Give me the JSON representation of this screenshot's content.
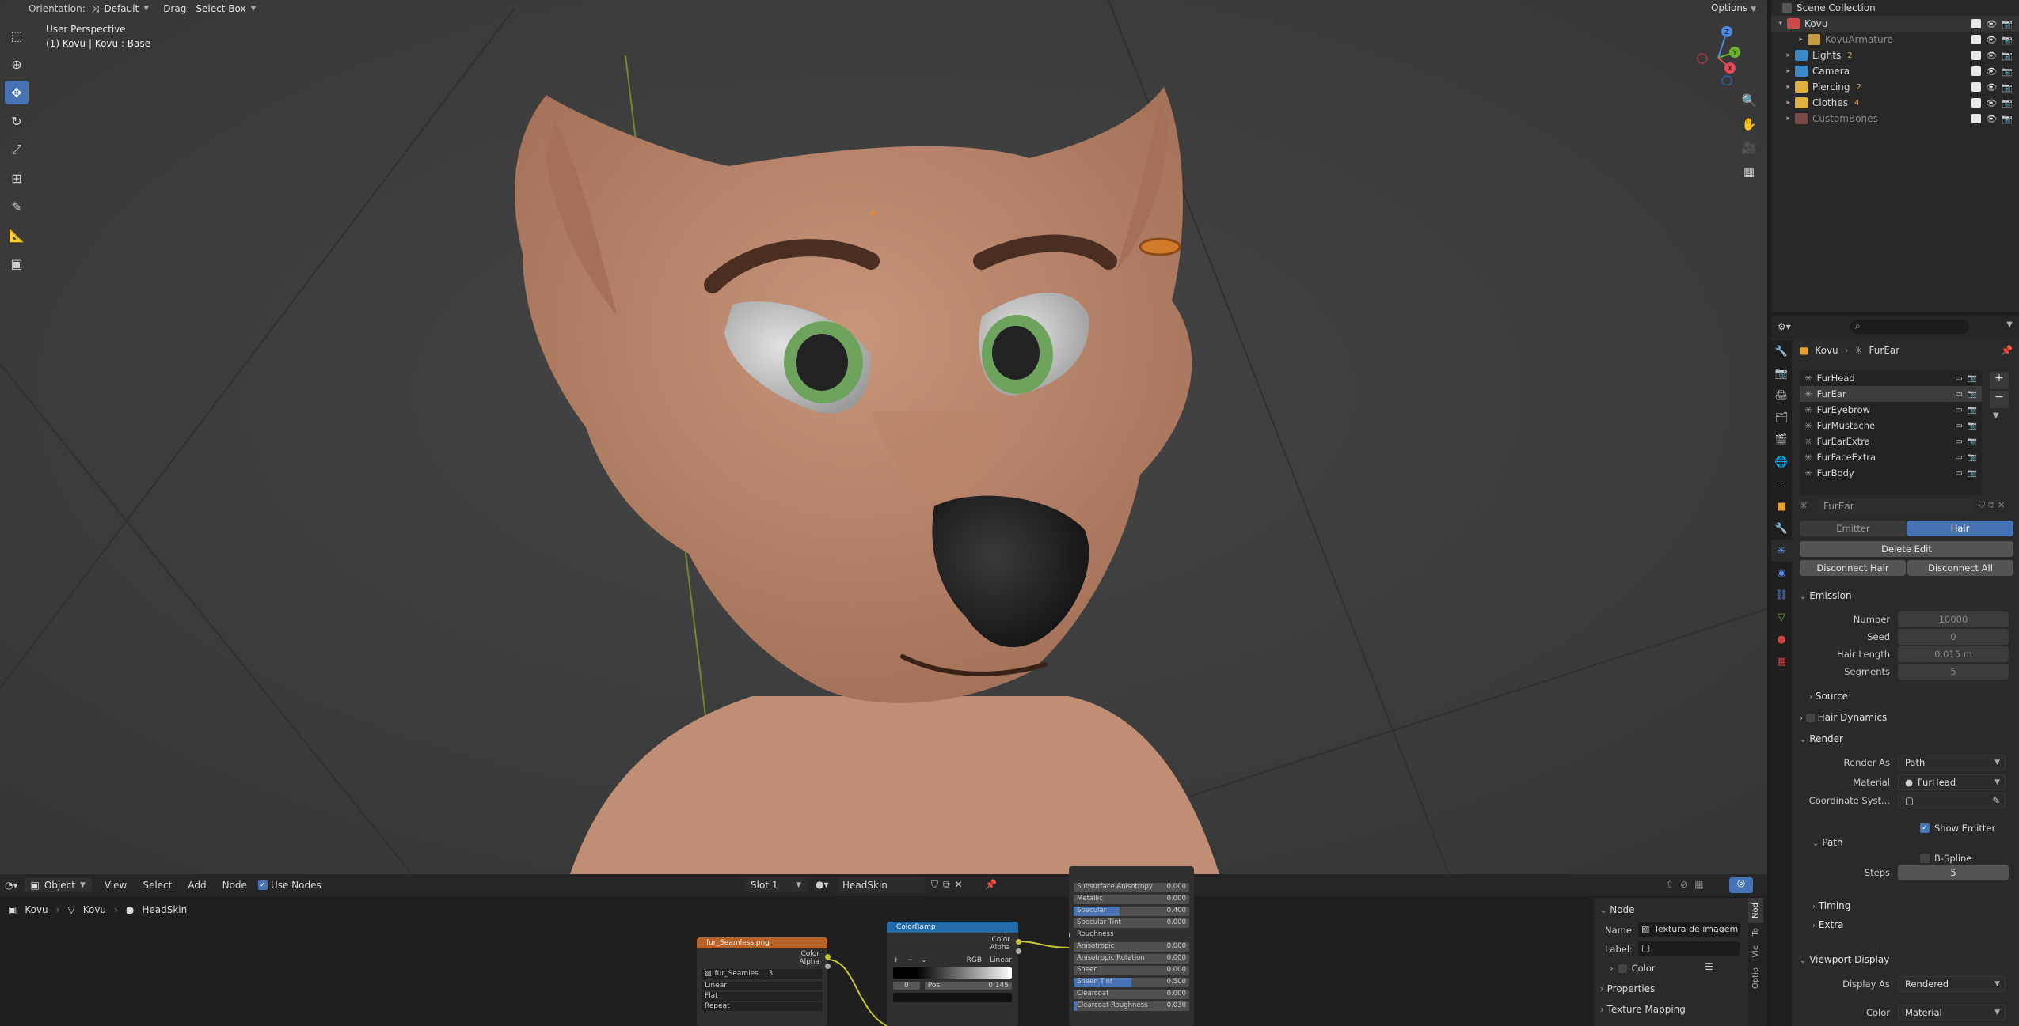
{
  "viewport": {
    "orientation_label": "Orientation:",
    "orientation_value": "Default",
    "drag_label": "Drag:",
    "drag_value": "Select Box",
    "options_label": "Options",
    "perspective": "User Perspective",
    "active_object": "(1) Kovu | Kovu : Base",
    "tools": [
      "cursor-select-icon",
      "cursor-3d-icon",
      "move-icon",
      "rotate-icon",
      "scale-icon",
      "transform-icon",
      "annotate-icon",
      "measure-icon",
      "add-cube-icon"
    ],
    "gizmo": {
      "z": "Z",
      "y": "Y",
      "x": "X"
    }
  },
  "outliner": {
    "title": "Scene Collection",
    "items": [
      {
        "label": "Kovu",
        "color": "#c94a4a",
        "badge": ""
      },
      {
        "label": "KovuArmature",
        "color": "#c49a45",
        "badge": ""
      },
      {
        "label": "Lights",
        "color": "#3a8ac9",
        "badge": "2"
      },
      {
        "label": "Camera",
        "color": "#3a8ac9",
        "badge": ""
      },
      {
        "label": "Piercing",
        "color": "#e0b040",
        "badge": "2"
      },
      {
        "label": "Clothes",
        "color": "#e0b040",
        "badge": "4"
      },
      {
        "label": "CustomBones",
        "color": "#7a4a4a",
        "badge": ""
      }
    ]
  },
  "properties": {
    "search_placeholder": "",
    "breadcrumb": [
      "Kovu",
      "FurEar"
    ],
    "systems": [
      "FurHead",
      "FurEar",
      "FurEyebrow",
      "FurMustache",
      "FurEarExtra",
      "FurFaceExtra",
      "FurBody"
    ],
    "selected_system": "FurEar",
    "type_tabs": [
      "Emitter",
      "Hair"
    ],
    "delete_edit": "Delete Edit",
    "disconnect_hair": "Disconnect Hair",
    "disconnect_all": "Disconnect All",
    "emission": {
      "title": "Emission",
      "number_label": "Number",
      "number": "10000",
      "seed_label": "Seed",
      "seed": "0",
      "length_label": "Hair Length",
      "length": "0.015 m",
      "segments_label": "Segments",
      "segments": "5"
    },
    "source": "Source",
    "hair_dynamics": "Hair Dynamics",
    "render": {
      "title": "Render",
      "render_as_label": "Render As",
      "render_as": "Path",
      "material_label": "Material",
      "material": "FurHead",
      "coord_label": "Coordinate Syst...",
      "show_emitter": "Show Emitter"
    },
    "path": {
      "title": "Path",
      "bspline": "B-Spline",
      "steps_label": "Steps",
      "steps": "5"
    },
    "timing": "Timing",
    "extra": "Extra",
    "viewport_display": {
      "title": "Viewport Display",
      "display_as_label": "Display As",
      "display_as": "Rendered",
      "color_label": "Color",
      "color": "Material"
    }
  },
  "node_editor": {
    "mode": "Object",
    "menus": [
      "View",
      "Select",
      "Add",
      "Node"
    ],
    "use_nodes": "Use Nodes",
    "slot": "Slot 1",
    "material": "HeadSkin",
    "breadcrumb": [
      "Kovu",
      "Kovu",
      "HeadSkin"
    ],
    "image_node": {
      "title": "fur_Seamless.png",
      "out_color": "Color",
      "out_alpha": "Alpha",
      "image": "fur_Seamles...",
      "users": "3",
      "interp": "Linear",
      "proj": "Flat",
      "ext": "Repeat"
    },
    "ramp_node": {
      "title": "ColorRamp",
      "out_color": "Color",
      "out_alpha": "Alpha",
      "mode": "RGB",
      "interp": "Linear",
      "index": "0",
      "pos_label": "Pos",
      "pos": "0.145"
    },
    "bsdf_rows": [
      {
        "label": "Subsurface Anisotropy",
        "value": "0.000",
        "fill": 0
      },
      {
        "label": "Metallic",
        "value": "0.000",
        "fill": 0
      },
      {
        "label": "Specular",
        "value": "0.400",
        "fill": 0.4
      },
      {
        "label": "Specular Tint",
        "value": "0.000",
        "fill": 0
      },
      {
        "label": "Roughness",
        "value": "",
        "fill": 0
      },
      {
        "label": "Anisotropic",
        "value": "0.000",
        "fill": 0
      },
      {
        "label": "Anisotropic Rotation",
        "value": "0.000",
        "fill": 0
      },
      {
        "label": "Sheen",
        "value": "0.000",
        "fill": 0
      },
      {
        "label": "Sheen Tint",
        "value": "0.500",
        "fill": 0.5
      },
      {
        "label": "Clearcoat",
        "value": "0.000",
        "fill": 0
      },
      {
        "label": "Clearcoat Roughness",
        "value": "0.030",
        "fill": 0.03
      }
    ],
    "sidebar": {
      "section": "Node",
      "name_label": "Name:",
      "name": "Textura de imagem",
      "label_label": "Label:",
      "color": "Color",
      "properties": "Properties",
      "texture_mapping": "Texture Mapping",
      "tabs": [
        "Nod",
        "To",
        "Vie",
        "Optio"
      ]
    }
  }
}
